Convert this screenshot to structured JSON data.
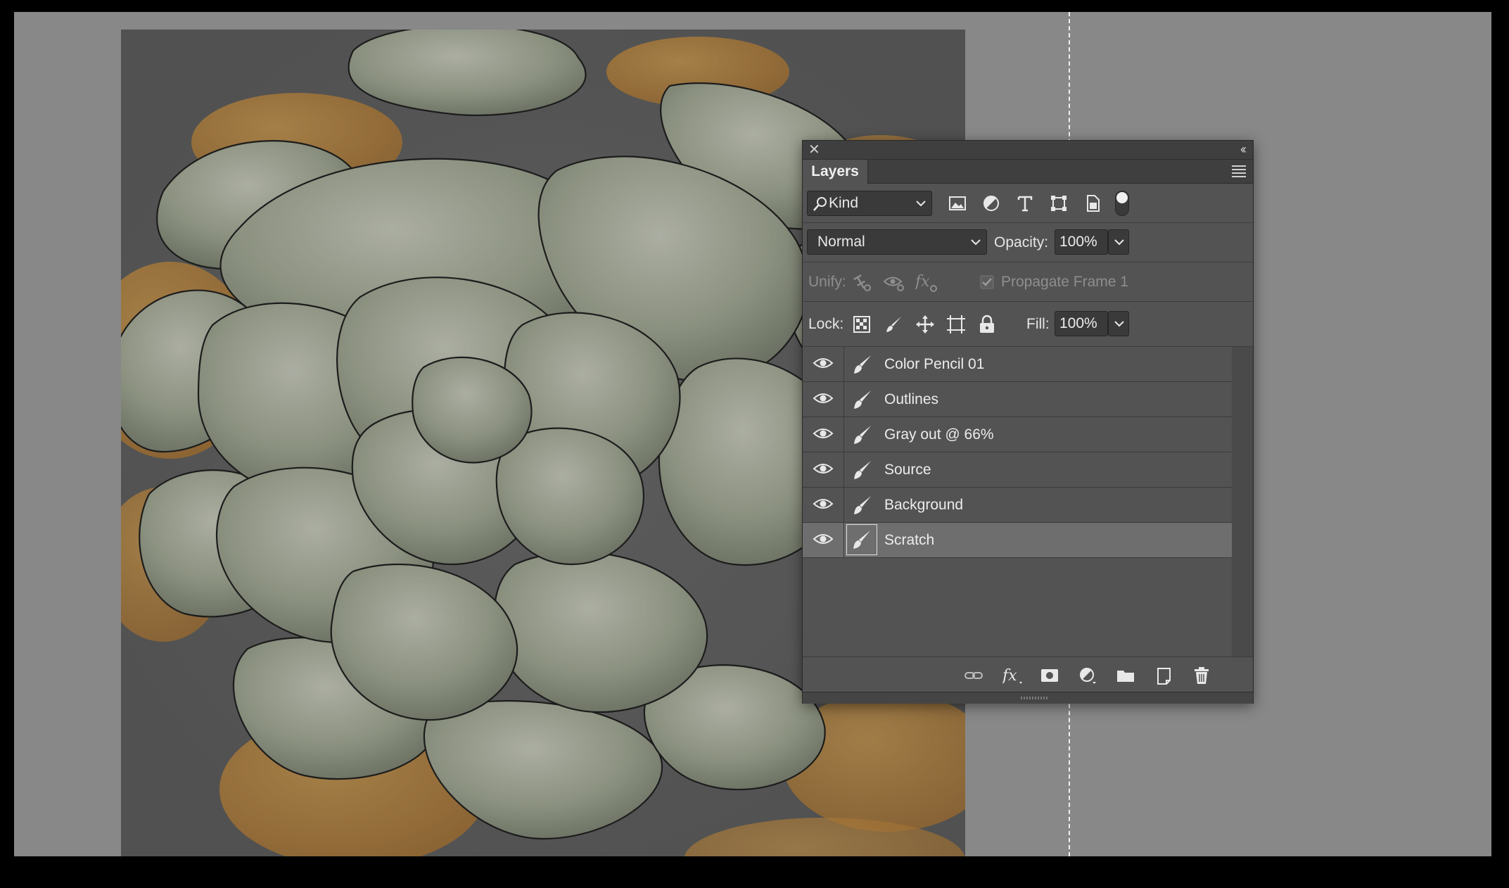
{
  "panel": {
    "tab_title": "Layers",
    "close_glyph": "✕",
    "collapse_glyph": "‹‹"
  },
  "filter": {
    "kind_label": "Kind",
    "icons": [
      "image-filter-icon",
      "adjustment-filter-icon",
      "type-filter-icon",
      "shape-filter-icon",
      "smart-object-filter-icon"
    ]
  },
  "blend": {
    "mode": "Normal",
    "opacity_label": "Opacity:",
    "opacity_value": "100%"
  },
  "unify": {
    "label": "Unify:",
    "propagate_label": "Propagate Frame 1",
    "propagate_checked": true
  },
  "lock": {
    "label": "Lock:",
    "fill_label": "Fill:",
    "fill_value": "100%"
  },
  "layers": [
    {
      "name": "Color Pencil 01",
      "visible": true,
      "selected": false
    },
    {
      "name": "Outlines",
      "visible": true,
      "selected": false
    },
    {
      "name": "Gray out @ 66%",
      "visible": true,
      "selected": false
    },
    {
      "name": "Source",
      "visible": true,
      "selected": false
    },
    {
      "name": "Background",
      "visible": true,
      "selected": false
    },
    {
      "name": "Scratch",
      "visible": true,
      "selected": true
    }
  ],
  "colors": {
    "workspace": "#888888",
    "panel": "#535353",
    "selected_row": "#6e6e6e",
    "orange": "#d8952e",
    "artichoke": "#a9ae96"
  }
}
